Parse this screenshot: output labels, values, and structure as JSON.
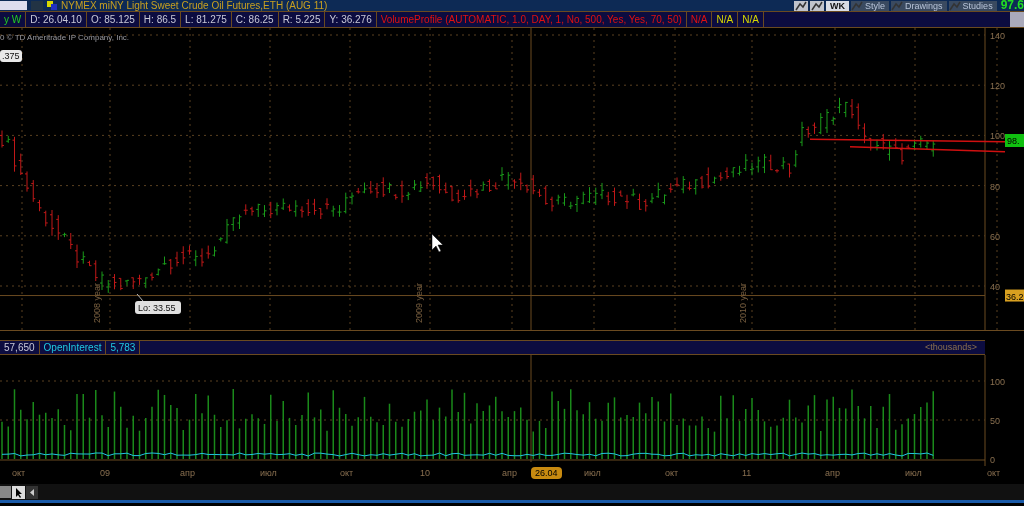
{
  "title_bar": {
    "title": "NYMEX miNY Light Sweet Crude Oil Futures,ETH (AUG 11)",
    "toolbar": [
      {
        "kind": "icon"
      },
      {
        "kind": "icon"
      },
      {
        "kind": "text",
        "label": "WK"
      },
      {
        "kind": "icon-text",
        "label": "Style"
      },
      {
        "kind": "icon-text",
        "label": "Drawings"
      },
      {
        "kind": "icon-text",
        "label": "Studies"
      }
    ],
    "last_price": "97.6"
  },
  "info_bar": {
    "items": [
      {
        "text": "y W",
        "kind": "period"
      },
      {
        "text": "D: 26.04.10",
        "kind": "field"
      },
      {
        "text": "O: 85.125",
        "kind": "field"
      },
      {
        "text": "H: 86.5",
        "kind": "field"
      },
      {
        "text": "L: 81.275",
        "kind": "field"
      },
      {
        "text": "C: 86.25",
        "kind": "field"
      },
      {
        "text": "R: 5.225",
        "kind": "field"
      },
      {
        "text": "Y: 36.276",
        "kind": "field"
      },
      {
        "text": "VolumeProfile (AUTOMATIC, 1.0, DAY, 1, No, 500, Yes, Yes, 70, 50)",
        "kind": "study"
      },
      {
        "text": "N/A",
        "kind": "study"
      },
      {
        "text": "N/A",
        "kind": "status"
      },
      {
        "text": "N/A",
        "kind": "status"
      }
    ]
  },
  "price_panel": {
    "copyright": "0 © TD Ameritrade IP Company, Inc.",
    "left_badge": ".375",
    "ticks": [
      "140",
      "120",
      "100",
      "80",
      "60",
      "40"
    ],
    "last_badge": "98.",
    "level_badge": "36.2",
    "low_label": "Lo: 33.55",
    "year_labels": [
      "2008 year",
      "2009 year",
      "2010 year"
    ]
  },
  "lower_panel": {
    "header": [
      {
        "text": "57,650",
        "kind": "field"
      },
      {
        "text": "OpenInterest",
        "kind": "study"
      },
      {
        "text": "5,783",
        "kind": "study"
      }
    ],
    "units": "<thousands>",
    "ticks": [
      "100",
      "50",
      "0"
    ]
  },
  "x_axis": [
    {
      "label": "окт",
      "selected": false
    },
    {
      "label": "09",
      "selected": false
    },
    {
      "label": "апр",
      "selected": false
    },
    {
      "label": "июл",
      "selected": false
    },
    {
      "label": "окт",
      "selected": false
    },
    {
      "label": "10",
      "selected": false
    },
    {
      "label": "апр",
      "selected": false
    },
    {
      "label": "26.04",
      "selected": true
    },
    {
      "label": "июл",
      "selected": false
    },
    {
      "label": "окт",
      "selected": false
    },
    {
      "label": "11",
      "selected": false
    },
    {
      "label": "апр",
      "selected": false
    },
    {
      "label": "июл",
      "selected": false
    },
    {
      "label": "окт",
      "selected": false
    }
  ]
}
